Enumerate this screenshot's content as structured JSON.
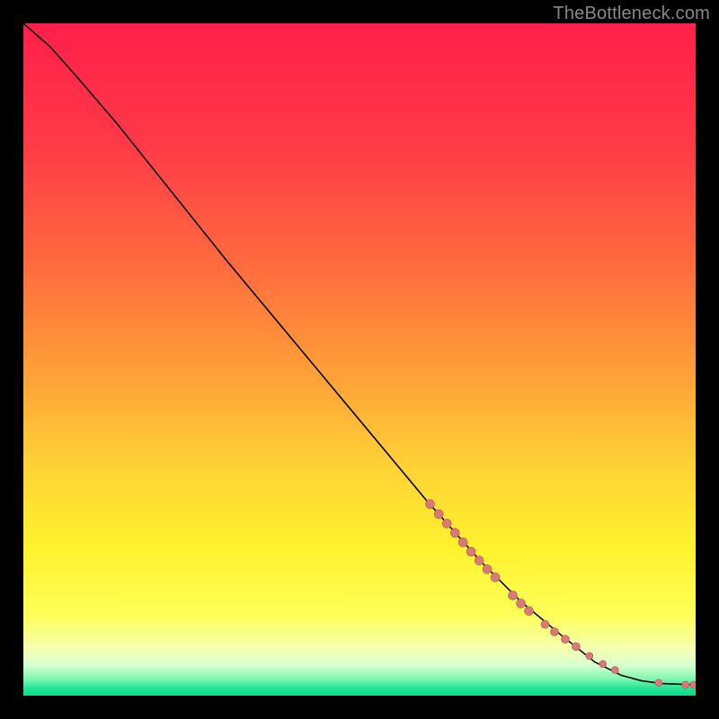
{
  "watermark": "TheBottleneck.com",
  "colors": {
    "background": "#000000",
    "watermark_text": "#888888",
    "curve": "#000000",
    "dot_fill": "#d97a78",
    "dot_stroke": "#b55a58",
    "gradient_stops": [
      {
        "offset": 0,
        "color": "#ff1f4a"
      },
      {
        "offset": 0.18,
        "color": "#ff3a48"
      },
      {
        "offset": 0.36,
        "color": "#ff6b3e"
      },
      {
        "offset": 0.53,
        "color": "#ffa338"
      },
      {
        "offset": 0.66,
        "color": "#ffd236"
      },
      {
        "offset": 0.78,
        "color": "#fff22e"
      },
      {
        "offset": 0.88,
        "color": "#ffff58"
      },
      {
        "offset": 0.93,
        "color": "#f5ffb0"
      },
      {
        "offset": 0.955,
        "color": "#d7ffd0"
      },
      {
        "offset": 0.975,
        "color": "#7ff7b0"
      },
      {
        "offset": 0.99,
        "color": "#1fe393"
      },
      {
        "offset": 1.0,
        "color": "#0fd989"
      }
    ]
  },
  "chart_data": {
    "type": "line",
    "title": "",
    "xlabel": "",
    "ylabel": "",
    "xlim": [
      0,
      100
    ],
    "ylim": [
      0,
      100
    ],
    "curve": {
      "points": [
        {
          "x": 0,
          "y": 100
        },
        {
          "x": 4,
          "y": 96.5
        },
        {
          "x": 8,
          "y": 92
        },
        {
          "x": 14,
          "y": 85
        },
        {
          "x": 22,
          "y": 75
        },
        {
          "x": 30,
          "y": 65
        },
        {
          "x": 40,
          "y": 53
        },
        {
          "x": 50,
          "y": 41
        },
        {
          "x": 60,
          "y": 29
        },
        {
          "x": 68,
          "y": 20
        },
        {
          "x": 74,
          "y": 14
        },
        {
          "x": 80,
          "y": 9
        },
        {
          "x": 85,
          "y": 5
        },
        {
          "x": 89,
          "y": 3
        },
        {
          "x": 92,
          "y": 2.2
        },
        {
          "x": 95,
          "y": 1.8
        },
        {
          "x": 100,
          "y": 1.6
        }
      ]
    },
    "series": [
      {
        "name": "cluster",
        "points": [
          {
            "x": 60.5,
            "y": 28.5,
            "r": 5
          },
          {
            "x": 61.8,
            "y": 27.0,
            "r": 5
          },
          {
            "x": 63.0,
            "y": 25.6,
            "r": 5
          },
          {
            "x": 64.2,
            "y": 24.2,
            "r": 5
          },
          {
            "x": 65.4,
            "y": 22.8,
            "r": 5
          },
          {
            "x": 66.6,
            "y": 21.4,
            "r": 5
          },
          {
            "x": 67.8,
            "y": 20.1,
            "r": 5
          },
          {
            "x": 69.0,
            "y": 18.8,
            "r": 5
          },
          {
            "x": 70.2,
            "y": 17.6,
            "r": 5
          },
          {
            "x": 72.8,
            "y": 14.9,
            "r": 5
          },
          {
            "x": 74.0,
            "y": 13.7,
            "r": 5
          },
          {
            "x": 75.2,
            "y": 12.6,
            "r": 5
          },
          {
            "x": 77.6,
            "y": 10.6,
            "r": 4.5
          },
          {
            "x": 79.0,
            "y": 9.5,
            "r": 4.5
          },
          {
            "x": 80.6,
            "y": 8.4,
            "r": 4.5
          },
          {
            "x": 82.2,
            "y": 7.3,
            "r": 4.5
          },
          {
            "x": 84.2,
            "y": 5.9,
            "r": 4
          },
          {
            "x": 86.2,
            "y": 4.7,
            "r": 4
          },
          {
            "x": 88.0,
            "y": 3.8,
            "r": 4
          },
          {
            "x": 94.5,
            "y": 1.9,
            "r": 4
          },
          {
            "x": 98.5,
            "y": 1.6,
            "r": 4
          },
          {
            "x": 99.7,
            "y": 1.6,
            "r": 4
          }
        ]
      }
    ]
  }
}
